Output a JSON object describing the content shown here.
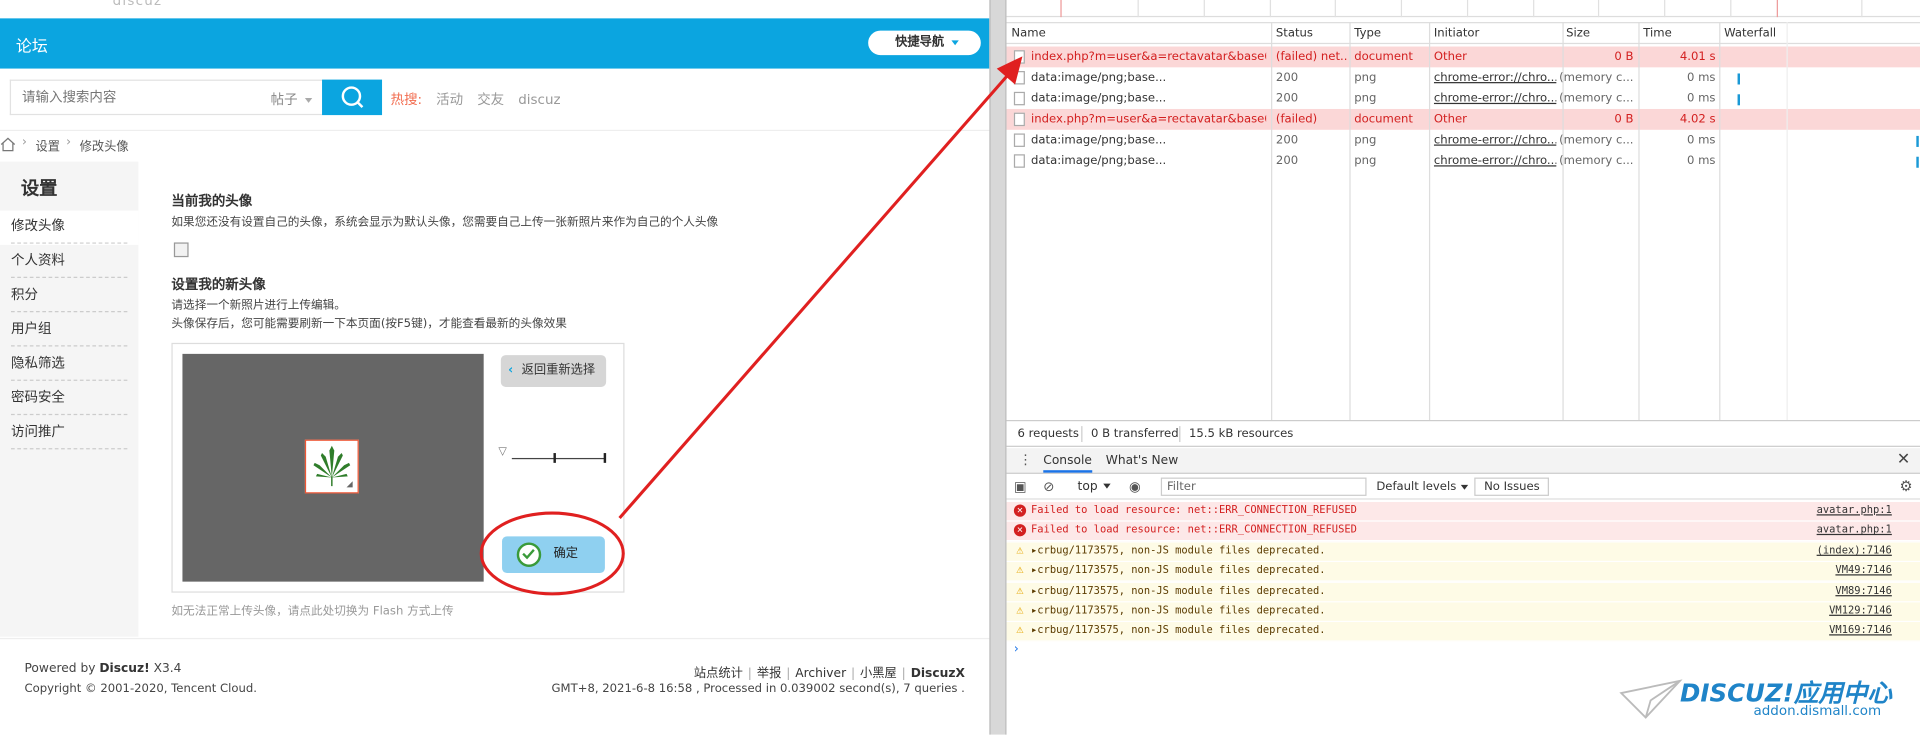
{
  "forum": {
    "brand": "discuz",
    "topbar_title": "论坛",
    "quick_nav": "快捷导航",
    "search_placeholder": "请输入搜索内容",
    "search_category": "帖子",
    "hot_label": "热搜:",
    "hot_items": [
      "活动",
      "交友",
      "discuz"
    ],
    "breadcrumb": [
      "设置",
      "修改头像"
    ],
    "sidebar_title": "设置",
    "sidebar_items": [
      "修改头像",
      "个人资料",
      "积分",
      "用户组",
      "隐私筛选",
      "密码安全",
      "访问推广"
    ],
    "current_avatar_title": "当前我的头像",
    "current_avatar_desc": "如果您还没有设置自己的头像，系统会显示为默认头像，您需要自己上传一张新照片来作为自己的个人头像",
    "new_avatar_title": "设置我的新头像",
    "new_avatar_desc1": "请选择一个新照片进行上传编辑。",
    "new_avatar_desc2": "头像保存后，您可能需要刷新一下本页面(按F5键)，才能查看最新的头像效果",
    "back_button": "返回重新选择",
    "zoom_level": 0.45,
    "confirm_button": "确定",
    "flash_hint": "如无法正常上传头像，请点此处切换为 Flash 方式上传",
    "footer": {
      "powered_prefix": "Powered by ",
      "powered_brand": "Discuz!",
      "powered_version": " X3.4",
      "copyright": "Copyright © 2001-2020, Tencent Cloud.",
      "links": [
        "站点统计",
        "举报",
        "Archiver",
        "小黑屋"
      ],
      "links_brand": "DiscuzX",
      "info": "GMT+8, 2021-6-8 16:58 , Processed in 0.039002 second(s), 7 queries ."
    }
  },
  "network": {
    "columns": [
      "Name",
      "Status",
      "Type",
      "Initiator",
      "Size",
      "Time",
      "Waterfall"
    ],
    "rows": [
      {
        "name": "index.php?m=user&a=rectavatar&base64...",
        "status": "(failed) net...",
        "type": "document",
        "initiator": "Other",
        "size": "0 B",
        "time": "4.01 s",
        "error": true
      },
      {
        "name": "data:image/png;base...",
        "status": "200",
        "type": "png",
        "initiator": "chrome-error://chro...",
        "size": "(memory c...",
        "time": "0 ms",
        "error": false
      },
      {
        "name": "data:image/png;base...",
        "status": "200",
        "type": "png",
        "initiator": "chrome-error://chro...",
        "size": "(memory c...",
        "time": "0 ms",
        "error": false
      },
      {
        "name": "index.php?m=user&a=rectavatar&base64...",
        "status": "(failed)",
        "type": "document",
        "initiator": "Other",
        "size": "0 B",
        "time": "4.02 s",
        "error": true
      },
      {
        "name": "data:image/png;base...",
        "status": "200",
        "type": "png",
        "initiator": "chrome-error://chro...",
        "size": "(memory c...",
        "time": "0 ms",
        "error": false
      },
      {
        "name": "data:image/png;base...",
        "status": "200",
        "type": "png",
        "initiator": "chrome-error://chro...",
        "size": "(memory c...",
        "time": "0 ms",
        "error": false
      }
    ],
    "summary": [
      "6 requests",
      "0 B transferred",
      "15.5 kB resources"
    ]
  },
  "console": {
    "tabs": [
      "Console",
      "What's New"
    ],
    "context": "top",
    "filter_placeholder": "Filter",
    "levels": "Default levels",
    "issues": "No Issues",
    "messages": [
      {
        "level": "error",
        "text": "Failed to load resource: net::ERR_CONNECTION_REFUSED",
        "source": "avatar.php:1"
      },
      {
        "level": "error",
        "text": "Failed to load resource: net::ERR_CONNECTION_REFUSED",
        "source": "avatar.php:1"
      },
      {
        "level": "warning",
        "text": "▸crbug/1173575, non-JS module files deprecated.",
        "source": "(index):7146"
      },
      {
        "level": "warning",
        "text": "▸crbug/1173575, non-JS module files deprecated.",
        "source": "VM49:7146"
      },
      {
        "level": "warning",
        "text": "▸crbug/1173575, non-JS module files deprecated.",
        "source": "VM89:7146"
      },
      {
        "level": "warning",
        "text": "▸crbug/1173575, non-JS module files deprecated.",
        "source": "VM129:7146"
      },
      {
        "level": "warning",
        "text": "▸crbug/1173575, non-JS module files deprecated.",
        "source": "VM169:7146"
      }
    ],
    "prompt": "›"
  },
  "watermark": {
    "logo": "DISCUZ!应用中心",
    "sub": "addon.dismall.com"
  },
  "colors": {
    "accent": "#0ba5e0",
    "error_row": "#fbd7d7",
    "annotation": "#e02020"
  }
}
